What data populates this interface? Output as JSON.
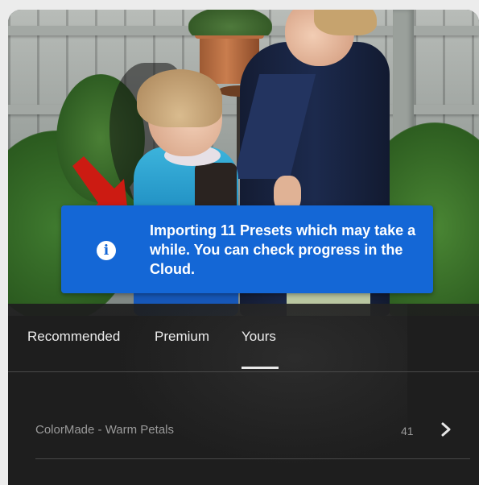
{
  "toast": {
    "icon": "info-icon",
    "icon_glyph": "i",
    "message": "Importing 11 Presets which may take a while. You can check progress in the Cloud.",
    "color": "#1467d6"
  },
  "annotation": {
    "icon": "red-arrow-icon",
    "color": "#cc1b12"
  },
  "tabs": [
    {
      "label": "Recommended",
      "selected": false
    },
    {
      "label": "Premium",
      "selected": false
    },
    {
      "label": "Yours",
      "selected": true
    }
  ],
  "preset_groups": [
    {
      "name": "ColorMade - Warm Petals",
      "count": "41",
      "icon": "chevron-right-icon"
    }
  ]
}
